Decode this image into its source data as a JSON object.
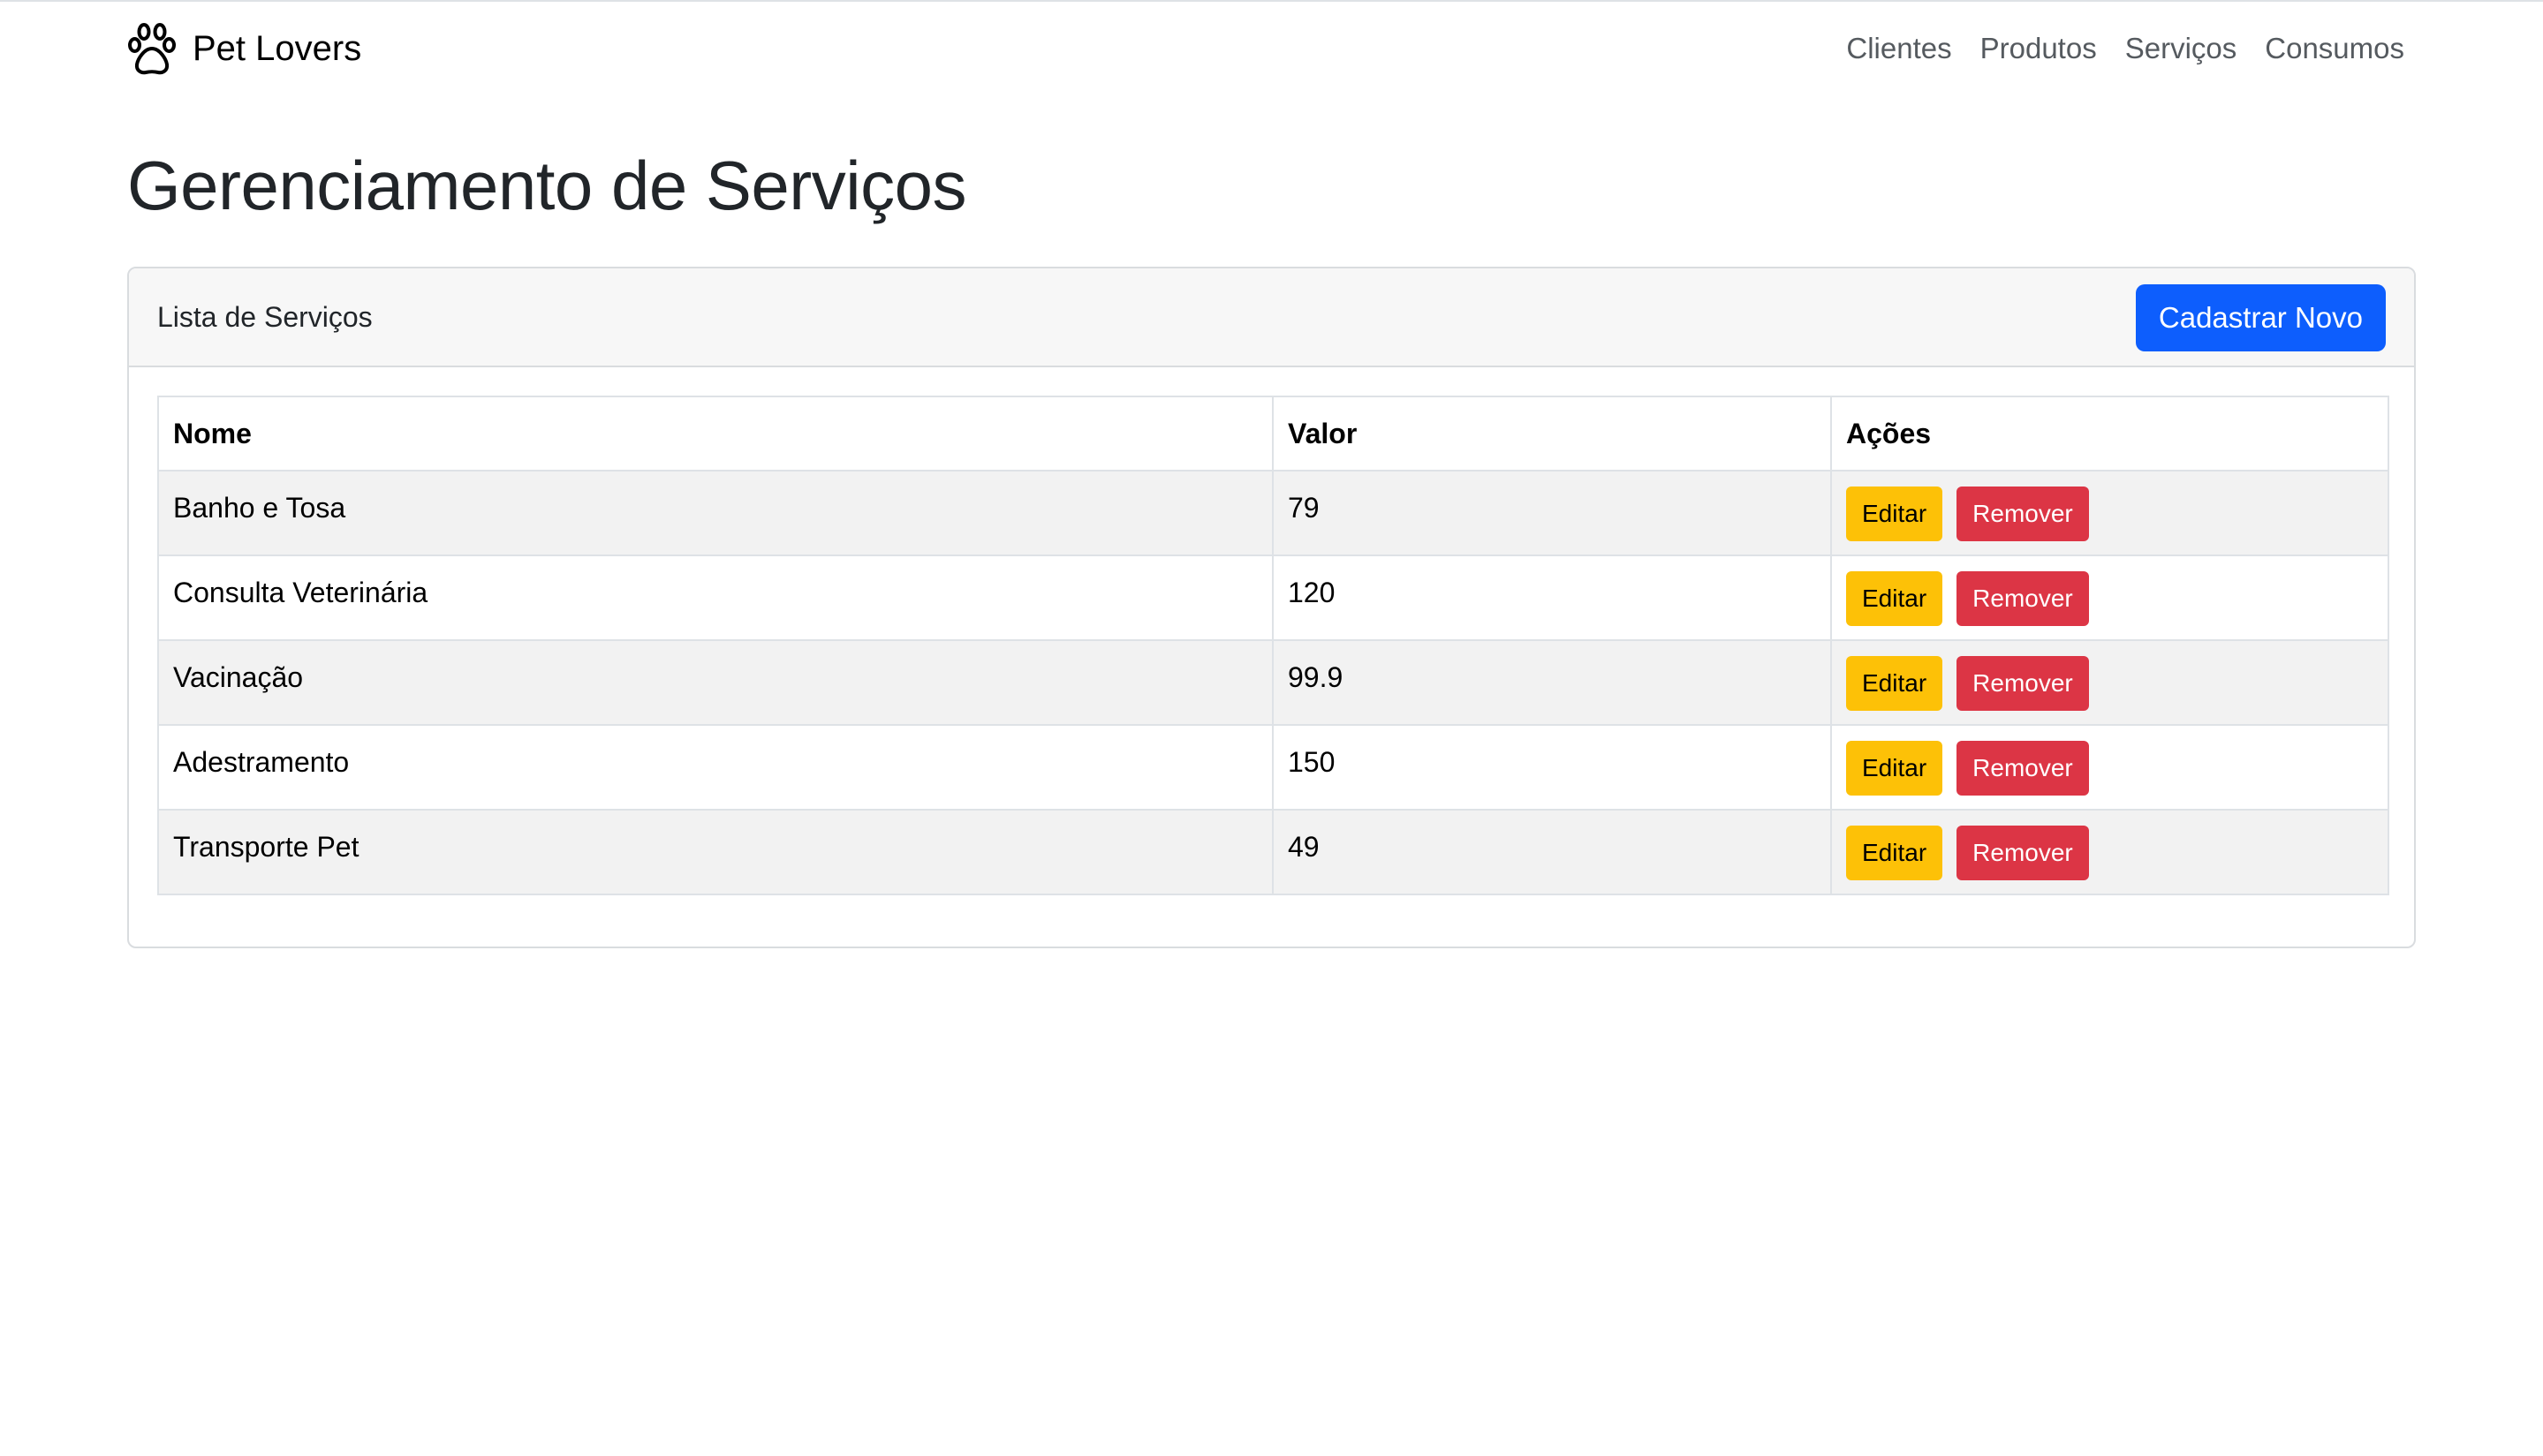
{
  "brand": {
    "name": "Pet Lovers",
    "icon": "paw-icon"
  },
  "nav": {
    "items": [
      {
        "label": "Clientes"
      },
      {
        "label": "Produtos"
      },
      {
        "label": "Serviços"
      },
      {
        "label": "Consumos"
      }
    ]
  },
  "page": {
    "title": "Gerenciamento de Serviços"
  },
  "card": {
    "title": "Lista de Serviços",
    "new_button": "Cadastrar Novo"
  },
  "table": {
    "headers": {
      "nome": "Nome",
      "valor": "Valor",
      "acoes": "Ações"
    },
    "rows": [
      {
        "nome": "Banho e Tosa",
        "valor": "79",
        "edit": "Editar",
        "remove": "Remover"
      },
      {
        "nome": "Consulta Veterinária",
        "valor": "120",
        "edit": "Editar",
        "remove": "Remover"
      },
      {
        "nome": "Vacinação",
        "valor": "99.9",
        "edit": "Editar",
        "remove": "Remover"
      },
      {
        "nome": "Adestramento",
        "valor": "150",
        "edit": "Editar",
        "remove": "Remover"
      },
      {
        "nome": "Transporte Pet",
        "valor": "49",
        "edit": "Editar",
        "remove": "Remover"
      }
    ]
  },
  "colors": {
    "primary": "#0d5efd",
    "warning": "#fdc107",
    "danger": "#dc3545",
    "card_header_bg": "#f7f7f7",
    "striped_row_bg": "#f2f2f2"
  }
}
